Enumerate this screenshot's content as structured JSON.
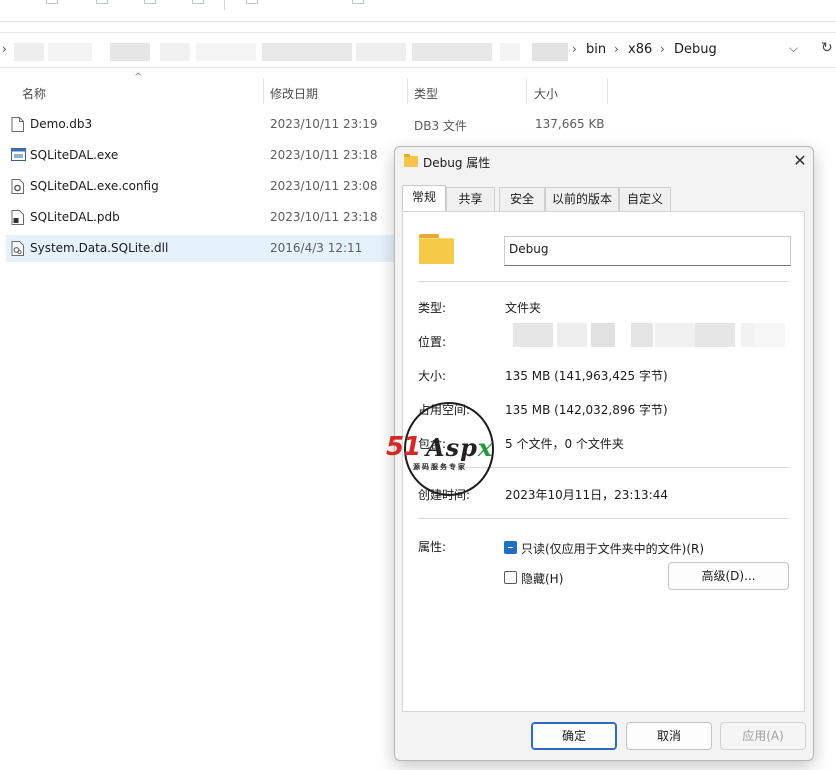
{
  "explorer": {
    "breadcrumb": [
      "bin",
      "x86",
      "Debug"
    ],
    "columns": {
      "name": "名称",
      "modified": "修改日期",
      "type": "类型",
      "size": "大小"
    },
    "files": [
      {
        "name": "Demo.db3",
        "modified": "2023/10/11 23:19",
        "type": "DB3 文件",
        "size": "137,665 KB",
        "icon": "file-icon"
      },
      {
        "name": "SQLiteDAL.exe",
        "modified": "2023/10/11 23:18",
        "type": "",
        "size": "",
        "icon": "exe-icon"
      },
      {
        "name": "SQLiteDAL.exe.config",
        "modified": "2023/10/11 23:08",
        "type": "",
        "size": "",
        "icon": "config-icon"
      },
      {
        "name": "SQLiteDAL.pdb",
        "modified": "2023/10/11 23:18",
        "type": "",
        "size": "",
        "icon": "pdb-icon"
      },
      {
        "name": "System.Data.SQLite.dll",
        "modified": "2016/4/3 12:11",
        "type": "",
        "size": "",
        "icon": "dll-icon",
        "selected": true
      }
    ]
  },
  "dialog": {
    "title": "Debug 属性",
    "tabs": [
      "常规",
      "共享",
      "安全",
      "以前的版本",
      "自定义"
    ],
    "active_tab": "常规",
    "folder_name": "Debug",
    "properties": {
      "type_label": "类型:",
      "type_value": "文件夹",
      "location_label": "位置:",
      "size_label": "大小:",
      "size_value": "135 MB (141,963,425 字节)",
      "disk_size_label": "占用空间:",
      "disk_size_value": "135 MB (142,032,896 字节)",
      "contains_label": "包含:",
      "contains_value": "5 个文件，0 个文件夹",
      "created_label": "创建时间:",
      "created_value": "2023年10月11日，23:13:44",
      "attributes_label": "属性:"
    },
    "attributes": {
      "readonly_label": "只读(仅应用于文件夹中的文件)(R)",
      "readonly_state": "indeterminate",
      "hidden_label": "隐藏(H)",
      "hidden_checked": false,
      "advanced_button": "高级(D)..."
    },
    "buttons": {
      "ok": "确定",
      "cancel": "取消",
      "apply": "应用(A)"
    }
  },
  "watermark": {
    "brand_number": "51",
    "brand_text_a": "Asp",
    "brand_text_x": "x",
    "subtitle": "源码服务专家"
  },
  "colors": {
    "accent": "#1f6fc5",
    "selection": "#e5f1fb",
    "folder": "#f7c948",
    "watermark_red": "#d62727",
    "watermark_green": "#1f9a3c"
  }
}
